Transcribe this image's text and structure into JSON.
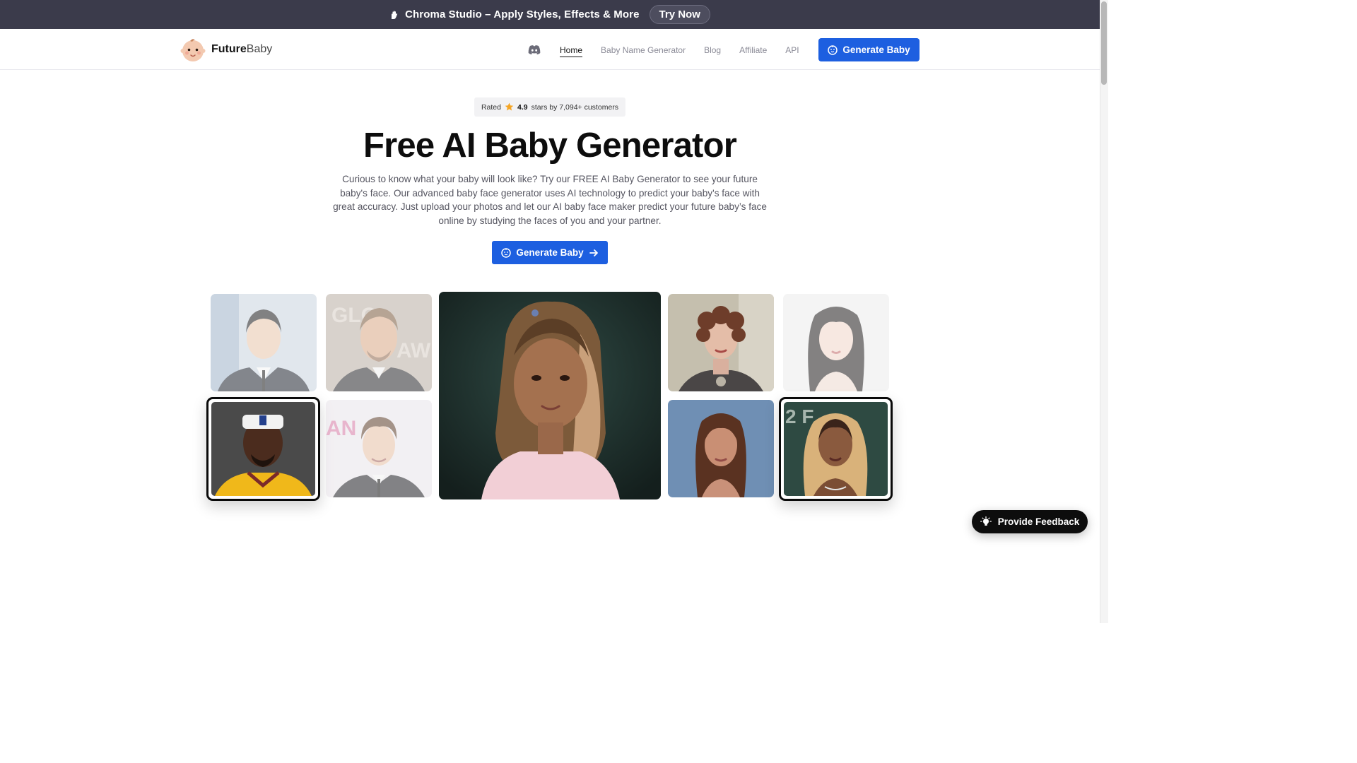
{
  "promo": {
    "icon": "hand-wave-icon",
    "text": "Chroma Studio – Apply Styles, Effects & More",
    "button": "Try Now"
  },
  "header": {
    "logo_strong": "Future",
    "logo_light": "Baby",
    "nav": [
      {
        "label": "Home",
        "active": true
      },
      {
        "label": "Baby Name Generator",
        "active": false
      },
      {
        "label": "Blog",
        "active": false
      },
      {
        "label": "Affiliate",
        "active": false
      },
      {
        "label": "API",
        "active": false
      }
    ],
    "cta": "Generate Baby"
  },
  "rating": {
    "prefix": "Rated",
    "score": "4.9",
    "suffix": "stars by 7,094+ customers"
  },
  "hero": {
    "title": "Free AI Baby Generator",
    "description": "Curious to know what your baby will look like? Try our FREE AI Baby Generator to see your future baby's face. Our advanced baby face generator uses AI technology to predict your baby's face with great accuracy. Just upload your photos and let our AI baby face maker predict your future baby’s face online by studying the faces of you and your partner.",
    "cta": "Generate Baby"
  },
  "feedback": {
    "label": "Provide Feedback"
  },
  "colors": {
    "accent": "#1d5fe0",
    "banner": "#3b3b4b",
    "dark": "#0d0d0d"
  }
}
